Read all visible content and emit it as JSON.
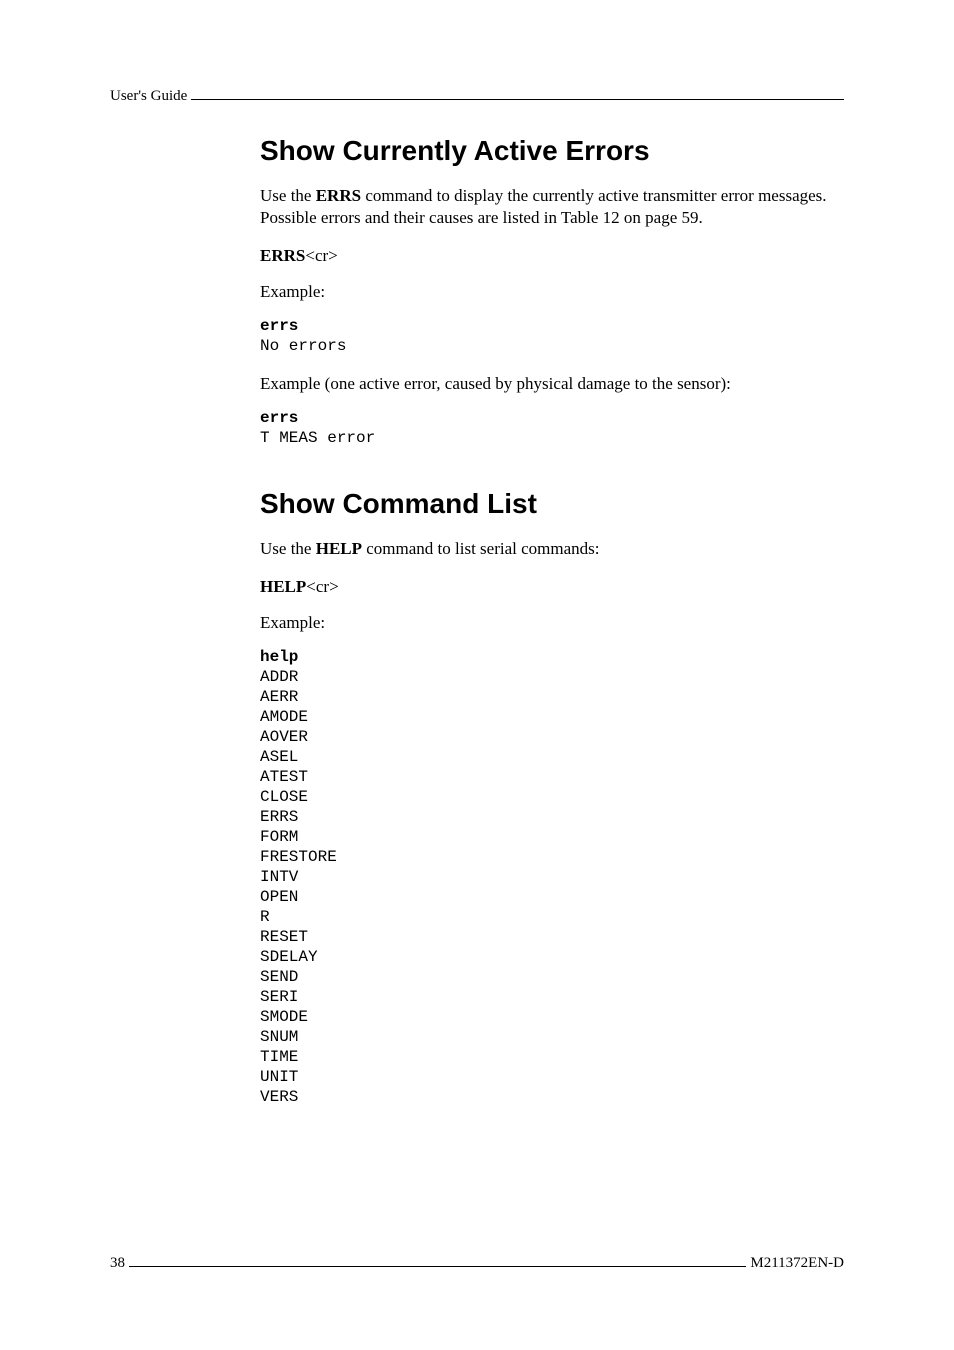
{
  "header": {
    "label": "User's Guide"
  },
  "section1": {
    "heading": "Show Currently Active Errors",
    "para1_pre": "Use the ",
    "para1_cmd": "ERRS",
    "para1_post": " command to display the currently active transmitter error messages. Possible errors and their causes are listed in Table 12 on page 59.",
    "syntax_cmd": "ERRS",
    "syntax_suffix": "<cr>",
    "example1_label": "Example:",
    "example1_cmd": "errs",
    "example1_out": "No errors",
    "example2_label": "Example (one active error, caused by physical damage to the sensor):",
    "example2_cmd": "errs",
    "example2_out": "T MEAS error"
  },
  "section2": {
    "heading": "Show Command List",
    "para1_pre": "Use the ",
    "para1_cmd": "HELP",
    "para1_post": " command to list serial commands:",
    "syntax_cmd": "HELP",
    "syntax_suffix": "<cr>",
    "example_label": "Example:",
    "example_cmd": "help",
    "example_out": "ADDR\nAERR\nAMODE\nAOVER\nASEL\nATEST\nCLOSE\nERRS\nFORM\nFRESTORE\nINTV\nOPEN\nR\nRESET\nSDELAY\nSEND\nSERI\nSMODE\nSNUM\nTIME\nUNIT\nVERS"
  },
  "footer": {
    "page": "38",
    "docid": "M211372EN-D"
  }
}
